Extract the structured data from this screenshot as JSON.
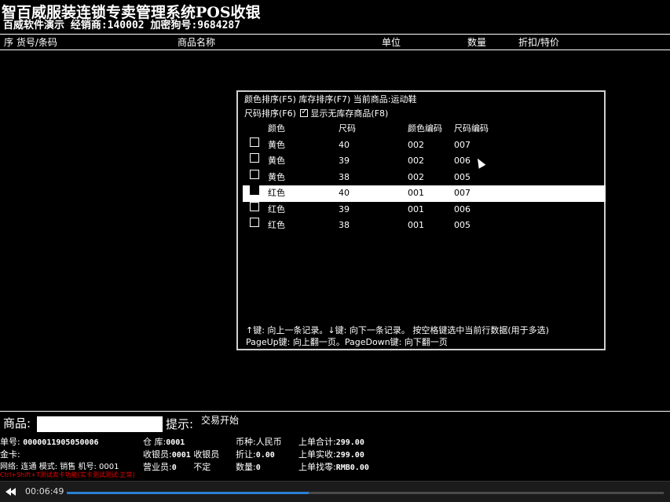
{
  "title": {
    "main": "智百威服装连锁专卖管理系统POS收银",
    "sub": "百威软件演示 经销商:140002 加密狗号:9684287"
  },
  "columns": [
    "序 货号/条码",
    "商品名称",
    "单位",
    "数量",
    "折扣/特价"
  ],
  "dialog": {
    "line1": "颜色排序(F5) 库存排序(F7) 当前商品:运动鞋",
    "line2_label": "尺码排序(F6)",
    "show_no_stock": true,
    "show_no_stock_label": "显示无库存商品(F8)",
    "headers": [
      "颜色",
      "尺码",
      "颜色编码",
      "尺码编码"
    ],
    "rows": [
      {
        "color": "黄色",
        "size": "40",
        "color_code": "002",
        "size_code": "007",
        "checked": false
      },
      {
        "color": "黄色",
        "size": "39",
        "color_code": "002",
        "size_code": "006",
        "checked": false
      },
      {
        "color": "黄色",
        "size": "38",
        "color_code": "002",
        "size_code": "005",
        "checked": false
      },
      {
        "color": "红色",
        "size": "40",
        "color_code": "001",
        "size_code": "007",
        "checked": true,
        "selected": true
      },
      {
        "color": "红色",
        "size": "39",
        "color_code": "001",
        "size_code": "006",
        "checked": false
      },
      {
        "color": "红色",
        "size": "38",
        "color_code": "001",
        "size_code": "005",
        "checked": false
      }
    ],
    "help1": "↑键: 向上一条记录。↓键: 向下一条记录。 按空格键选中当前行数据(用于多选)",
    "help2": "PageUp键: 向上翻一页。PageDown键: 向下翻一页"
  },
  "bottom": {
    "product_label": "商品:",
    "product_value": "",
    "hint_label": "提示:",
    "hint_value": "交易开始",
    "order_no_label": "单号:",
    "order_no": "0000011905050006",
    "gold_card_label": "金卡:",
    "network": "网络: 连通 模式: 销售 机号: 0001",
    "warehouse_label": "仓  库:",
    "warehouse": "0001",
    "cashier_label": "收银员:",
    "cashier": "0001",
    "cashier_role": "收银员",
    "salesperson_label": "营业员:",
    "salesperson": "0",
    "salesperson_extra": "不定",
    "currency_label": "币种:",
    "currency": "人民币",
    "discount_label": "折让:",
    "discount": "0.00",
    "qty_label": "数量:",
    "qty": "0",
    "last_total_label": "上单合计:",
    "last_total": "299.00",
    "last_paid_label": "上单实收:",
    "last_paid": "299.00",
    "last_change_label": "上单找零:",
    "last_change": "RMB0.00",
    "ctrl_hint": "Ctrl+Shift+T测试卖卡功能(实卡测试测试:正常)"
  },
  "player": {
    "time": "00:06:49",
    "progress": 0.405
  }
}
